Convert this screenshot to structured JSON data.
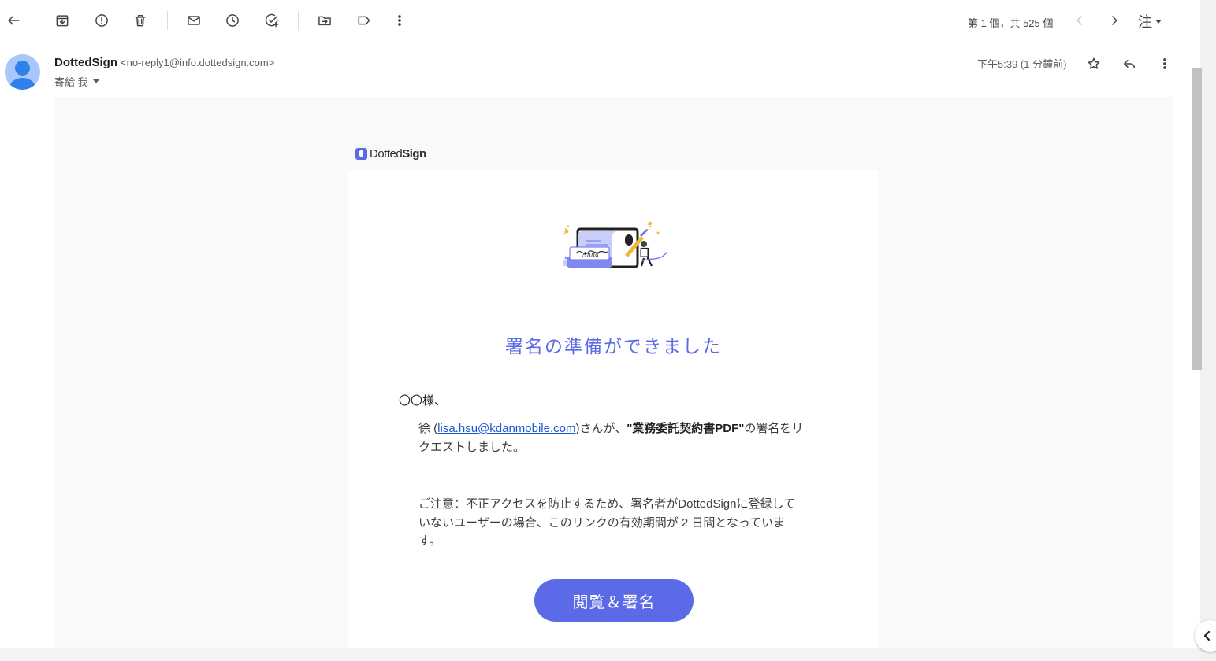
{
  "toolbar": {
    "back": "back-arrow-icon",
    "archive": "archive-icon",
    "spam": "report-spam-icon",
    "delete": "trash-icon",
    "mark_unread": "envelope-icon",
    "snooze": "clock-icon",
    "add_task": "add-task-icon",
    "move": "move-to-folder-icon",
    "label": "label-icon",
    "more": "more-vert-icon",
    "pager_text": "第 1 個，共 525 個",
    "lang_label": "注"
  },
  "header": {
    "sender_name": "DottedSign",
    "sender_email": "<no-reply1@info.dottedsign.com>",
    "to_text": "寄給 我",
    "timestamp": "下午5:39 (1 分鐘前)"
  },
  "email": {
    "logo_light": "Dotted",
    "logo_bold": "Sign",
    "illustration_signature": "Anna",
    "headline": "署名の準備ができました",
    "greeting": "〇〇様、",
    "requester_name": "徐 (",
    "requester_email": "lisa.hsu@kdanmobile.com",
    "request_mid": ")さんが、",
    "document_name": "\"業務委託契約書PDF\"",
    "request_end": "の署名をリクエストしました。",
    "notice": "ご注意：不正アクセスを防止するため、署名者がDottedSignに登録していないユーザーの場合、このリンクの有効期間が 2 日間となっています。",
    "cta_label": "閲覧＆署名"
  },
  "colors": {
    "accent": "#5b6ae6",
    "link": "#1a57d6",
    "email_bg": "#f8f9fa",
    "avatar_bg": "#a8c7fa"
  }
}
